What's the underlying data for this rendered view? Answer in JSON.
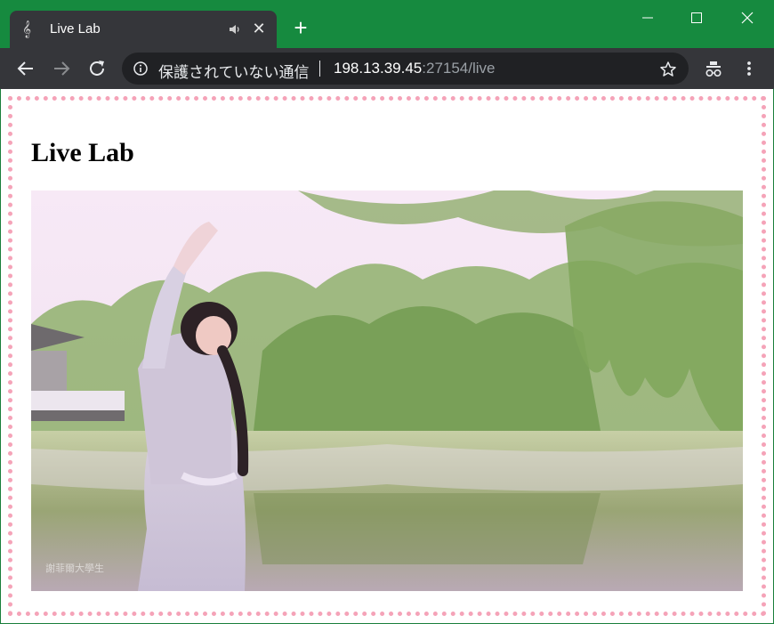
{
  "browser": {
    "tab": {
      "title": "Live Lab",
      "favicon": "treble-clef-icon",
      "favicon_glyph": "𝄞",
      "audio_icon": "speaker-icon",
      "close_glyph": "✕"
    },
    "new_tab_glyph": "+",
    "window_controls": {
      "minimize": "minimize-icon",
      "maximize": "maximize-icon",
      "close": "close-icon"
    },
    "toolbar": {
      "back": "back-arrow-icon",
      "forward": "forward-arrow-icon",
      "reload": "reload-icon",
      "security_text": "保護されていない通信",
      "url_host": "198.13.39.45",
      "url_rest": ":27154/live",
      "bookmark": "star-icon",
      "extension": "incognito-icon",
      "menu": "kebab-menu-icon"
    },
    "colors": {
      "frame": "#168a3f",
      "toolbar": "#35363a",
      "omnibox": "#202124",
      "border_dots": "#f5a3b8"
    }
  },
  "page": {
    "heading": "Live Lab",
    "video": {
      "kind": "video-frame",
      "watermark": "謝菲爾大學生"
    }
  }
}
